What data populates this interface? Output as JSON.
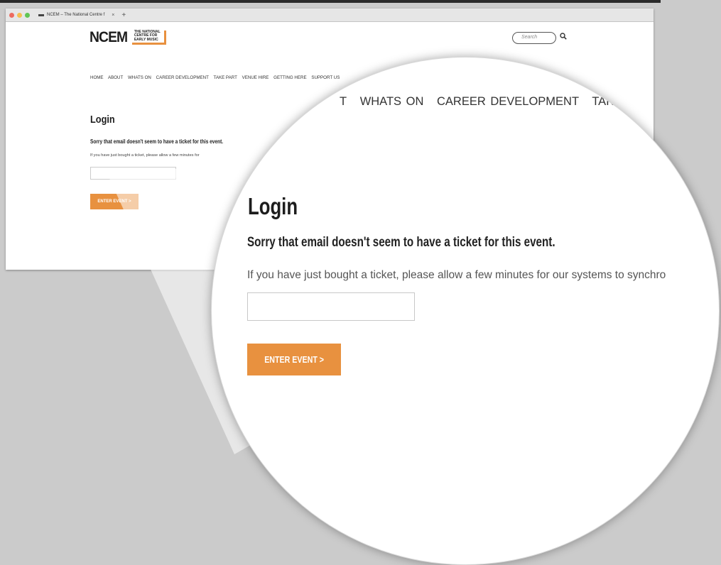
{
  "browser": {
    "tab_title": "NCEM – The National Centre f",
    "tab_close": "×",
    "new_tab": "+",
    "traffic_light_colors": [
      "#ed6a5e",
      "#f5bf4f",
      "#61c554"
    ]
  },
  "site": {
    "logo_main": "NCEM",
    "logo_sub": [
      "THE NATIONAL",
      "CENTRE FOR",
      "EARLY MUSIC"
    ],
    "accent_color": "#e8913f",
    "search_placeholder": "Search",
    "nav": [
      "HOME",
      "ABOUT",
      "WHATS ON",
      "CAREER DEVELOPMENT",
      "TAKE PART",
      "VENUE HIRE",
      "GETTING HERE",
      "SUPPORT US"
    ]
  },
  "login": {
    "heading": "Login",
    "error_message": "Sorry that email doesn't seem to have a ticket for this event.",
    "hint_small": "If you have just bought a ticket, please allow a few minutes for",
    "hint_zoom": "If you have just bought a ticket, please allow a few minutes for our systems to synchro",
    "email_value": "",
    "submit_label": "ENTER EVENT >"
  },
  "zoom_nav": [
    "T",
    "WHATS ON",
    "CAREER DEVELOPMENT",
    "TAKE PART"
  ]
}
